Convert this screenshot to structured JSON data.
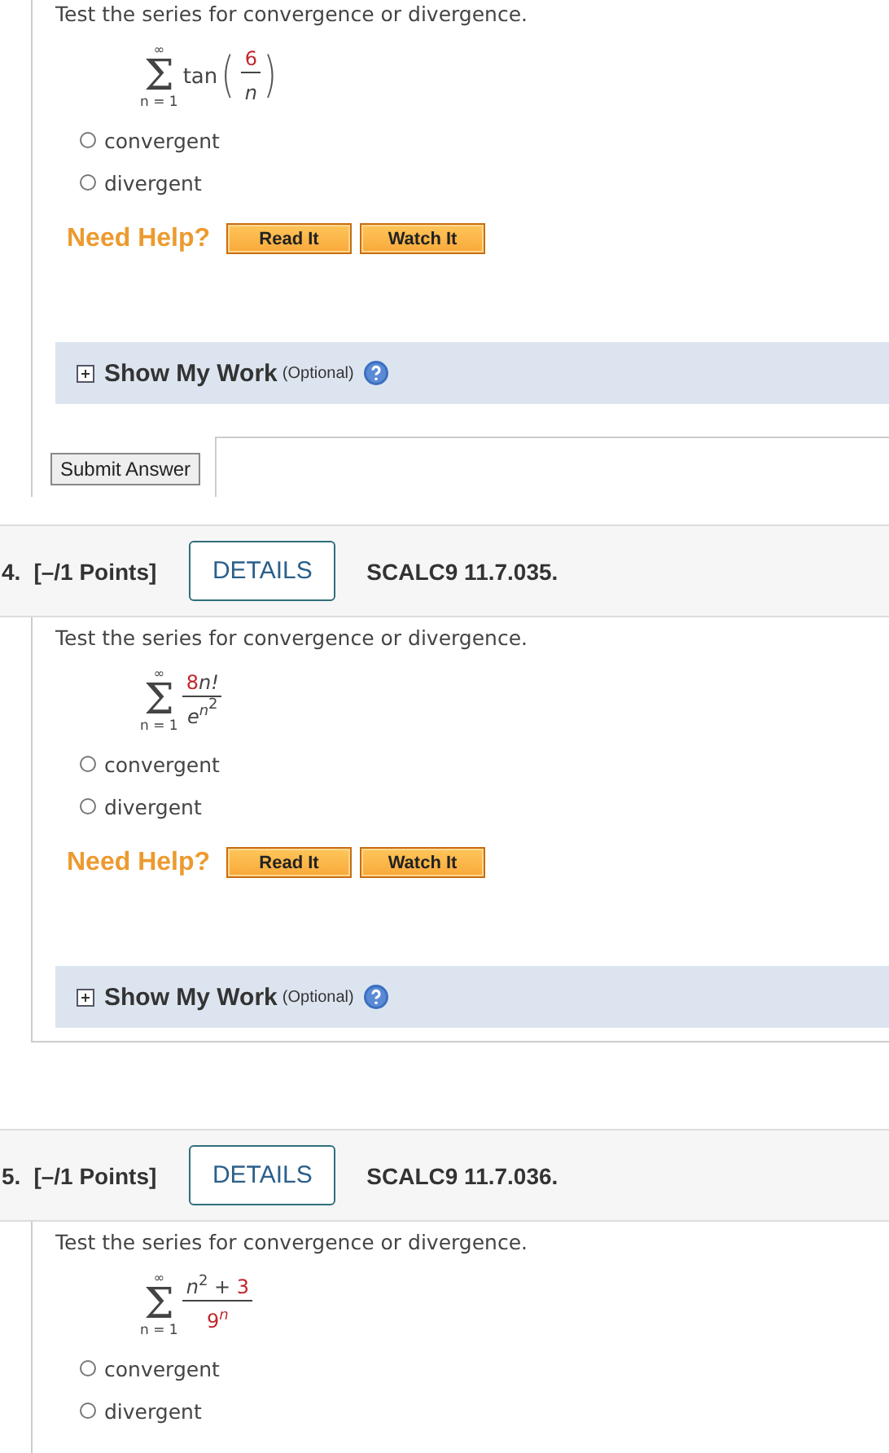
{
  "questions": [
    {
      "instruction": "Test the series for convergence or divergence.",
      "series": {
        "upper": "∞",
        "sigma": "Σ",
        "lower": "n = 1",
        "func": "tan",
        "open": "(",
        "close": ")",
        "numerator": [
          {
            "text": "6",
            "italic": false,
            "given": true
          }
        ],
        "denominator": [
          {
            "text": "n",
            "italic": true,
            "given": false
          }
        ]
      },
      "options": [
        {
          "label": "convergent",
          "selected": false
        },
        {
          "label": "divergent",
          "selected": false
        }
      ],
      "help": {
        "label": "Need Help?",
        "buttons": [
          "Read It",
          "Watch It"
        ]
      },
      "show_my_work": {
        "label": "Show My Work",
        "note": "(Optional)"
      },
      "submit": "Submit Answer"
    },
    {
      "header": {
        "number": "4.",
        "points": "[–/1 Points]",
        "details": "DETAILS",
        "code": "SCALC9 11.7.035."
      },
      "instruction": "Test the series for convergence or divergence.",
      "series": {
        "upper": "∞",
        "sigma": "Σ",
        "lower": "n = 1",
        "numerator": [
          {
            "text": "8",
            "italic": false,
            "given": true
          },
          {
            "text": "n!",
            "italic": true,
            "given": false
          }
        ],
        "denominator": [
          {
            "text": "e",
            "italic": true,
            "given": false,
            "sup": [
              {
                "text": "n",
                "italic": true,
                "given": false,
                "sup": [
                  {
                    "text": "2",
                    "italic": false,
                    "given": false
                  }
                ]
              }
            ]
          }
        ]
      },
      "options": [
        {
          "label": "convergent",
          "selected": false
        },
        {
          "label": "divergent",
          "selected": false
        }
      ],
      "help": {
        "label": "Need Help?",
        "buttons": [
          "Read It",
          "Watch It"
        ]
      },
      "show_my_work": {
        "label": "Show My Work",
        "note": "(Optional)"
      }
    },
    {
      "header": {
        "number": "5.",
        "points": "[–/1 Points]",
        "details": "DETAILS",
        "code": "SCALC9 11.7.036."
      },
      "instruction": "Test the series for convergence or divergence.",
      "series": {
        "upper": "∞",
        "sigma": "Σ",
        "lower": "n = 1",
        "numerator": [
          {
            "text": "n",
            "italic": true,
            "given": false,
            "sup": [
              {
                "text": "2",
                "italic": false,
                "given": false
              }
            ]
          },
          {
            "text": " + ",
            "given": false
          },
          {
            "text": "3",
            "italic": false,
            "given": true
          }
        ],
        "denominator": [
          {
            "text": "9",
            "italic": false,
            "given": true,
            "sup": [
              {
                "text": "n",
                "italic": true,
                "given": true
              }
            ]
          }
        ]
      },
      "options": [
        {
          "label": "convergent",
          "selected": false
        },
        {
          "label": "divergent",
          "selected": false
        }
      ]
    }
  ]
}
